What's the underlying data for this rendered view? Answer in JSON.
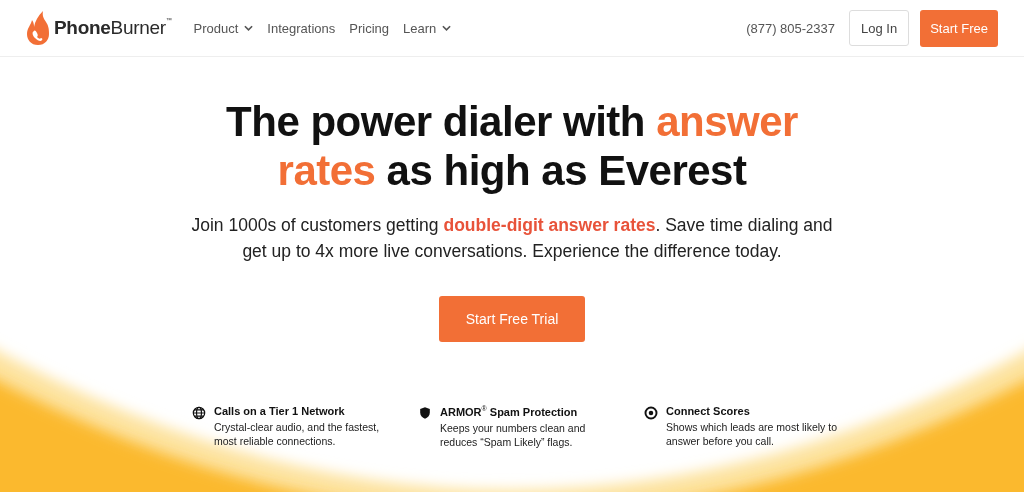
{
  "nav": {
    "logo": {
      "bold": "Phone",
      "light": "Burner",
      "mark": "™"
    },
    "links": [
      {
        "label": "Product",
        "dropdown": true
      },
      {
        "label": "Integrations",
        "dropdown": false
      },
      {
        "label": "Pricing",
        "dropdown": false
      },
      {
        "label": "Learn",
        "dropdown": true
      }
    ],
    "phone": "(877) 805-2337",
    "login": "Log In",
    "cta": "Start Free"
  },
  "hero": {
    "headline": [
      [
        {
          "text": "The power dialer with ",
          "highlight": false
        },
        {
          "text": "answer",
          "highlight": true
        }
      ],
      [
        {
          "text": "rates",
          "highlight": true
        },
        {
          "text": " as high as Everest",
          "highlight": false
        }
      ]
    ],
    "subtitle": [
      [
        {
          "text": "Join 1000s of customers getting ",
          "highlight": false
        },
        {
          "text": "double-digit answer rates",
          "highlight": true
        },
        {
          "text": ". Save time dialing and",
          "highlight": false
        }
      ],
      [
        {
          "text": "get up to 4x more live conversations. Experience the difference today.",
          "highlight": false
        }
      ]
    ],
    "cta": "Start Free Trial"
  },
  "features": [
    {
      "kind": "globe",
      "title": "Calls on a Tier 1 Network",
      "text": "Crystal-clear audio, and the fastest, most reliable connections."
    },
    {
      "kind": "shield",
      "title": "ARMOR$^{®}$ Spam Protection",
      "text": "Keeps your numbers clean and reduces “Spam Likely” flags."
    },
    {
      "kind": "target",
      "title": "Connect Scores",
      "text": "Shows which leads are most likely to answer before you call."
    }
  ]
}
